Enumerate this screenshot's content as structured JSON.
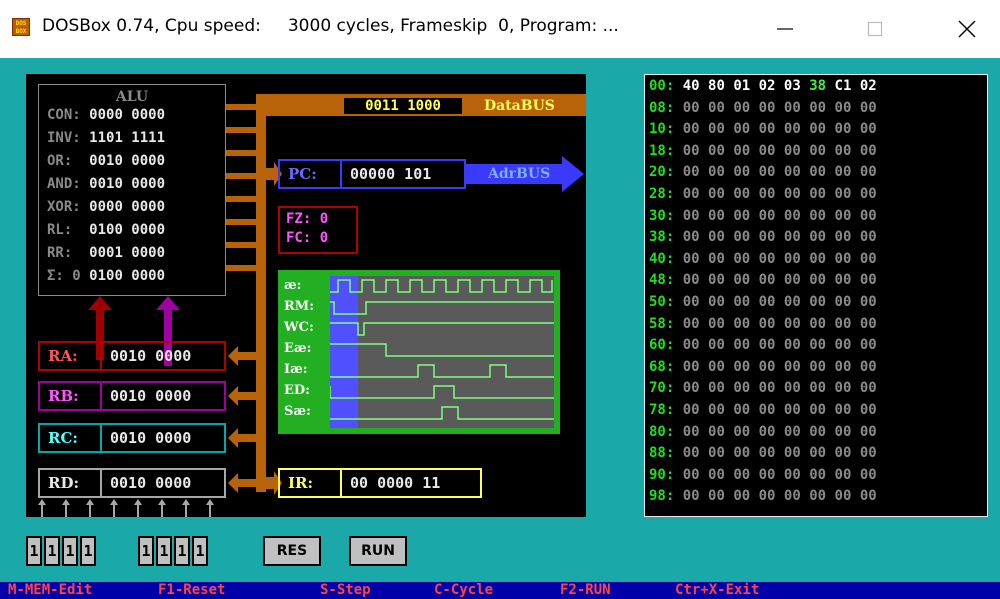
{
  "window": {
    "title": "DOSBox 0.74, Cpu speed:     3000 cycles, Frameskip  0, Program: ...",
    "icon": "dosbox-icon",
    "minimize_icon": "minimize-icon",
    "maximize_icon": "maximize-icon",
    "close_icon": "close-icon"
  },
  "alu": {
    "title": "ALU",
    "rows": [
      {
        "label": "CON:",
        "value": "0000 0000"
      },
      {
        "label": "INV:",
        "value": "1101 1111"
      },
      {
        "label": "OR: ",
        "value": "0010 0000"
      },
      {
        "label": "AND:",
        "value": "0010 0000"
      },
      {
        "label": "XOR:",
        "value": "0000 0000"
      },
      {
        "label": "RL: ",
        "value": "0100 0000"
      },
      {
        "label": "RR: ",
        "value": "0001 0000"
      },
      {
        "label": "Σ: 0",
        "value": "0100 0000"
      }
    ]
  },
  "databus": {
    "value": "0011 1000",
    "label": "DataBUS"
  },
  "adrbus": {
    "label": "AdrBUS"
  },
  "registers": {
    "pc": {
      "label": "PC:",
      "value": "00000 101"
    },
    "ra": {
      "label": "RA:",
      "value": "0010 0000"
    },
    "rb": {
      "label": "RB:",
      "value": "0010 0000"
    },
    "rc": {
      "label": "RC:",
      "value": "0010 0000"
    },
    "rd": {
      "label": "RD:",
      "value": "0010 0000"
    },
    "ir": {
      "label": "IR:",
      "value": "00 0000 11"
    }
  },
  "flags": {
    "fz": "FZ: 0",
    "fc": "FC: 0"
  },
  "signals": [
    "æ:",
    "RM:",
    "WC:",
    "Eæ:",
    "Iæ:",
    "ED:",
    "Sæ:"
  ],
  "memory": {
    "addresses": [
      "00:",
      "08:",
      "10:",
      "18:",
      "20:",
      "28:",
      "30:",
      "38:",
      "40:",
      "48:",
      "50:",
      "58:",
      "60:",
      "68:",
      "70:",
      "78:",
      "80:",
      "88:",
      "90:",
      "98:"
    ],
    "first_row": [
      "40",
      "80",
      "01",
      "02",
      "03",
      "38",
      "C1",
      "02"
    ],
    "fill": "00"
  },
  "switches": [
    "1",
    "1",
    "1",
    "1",
    "1",
    "1",
    "1",
    "1"
  ],
  "buttons": {
    "res": "RES",
    "run": "RUN"
  },
  "statusbar": [
    "M-MEM-Edit",
    "F1-Reset",
    "S-Step",
    "C-Cycle",
    "F2-RUN",
    "Ctr+X-Exit"
  ],
  "colors": {
    "dos_bg": "#1aa8a8",
    "bus_orange": "#b8620a",
    "pc_blue": "#3a3aff",
    "graph_green": "#22b022"
  }
}
